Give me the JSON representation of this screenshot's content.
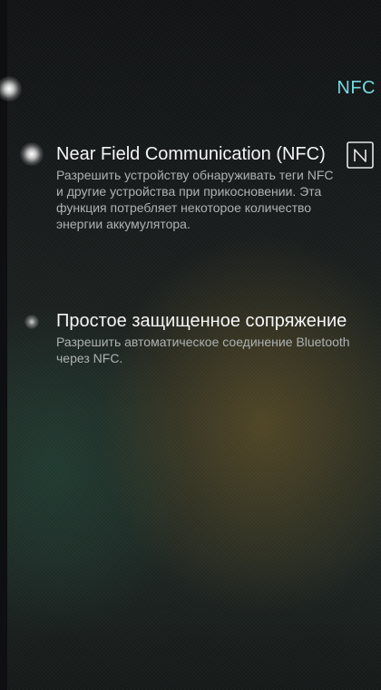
{
  "header": {
    "title": "NFC"
  },
  "settings": [
    {
      "title": "Near Field Communication (NFC)",
      "description": "Разрешить устройству обнаруживать теги NFC и другие устройства при прикосновении. Эта функция потребляет некоторое количество энергии аккумулятора.",
      "icon": "nfc-n-icon"
    },
    {
      "title": "Простое защищенное сопряжение",
      "description": "Разрешить автоматическое соединение Bluetooth через NFC."
    }
  ],
  "colors": {
    "accent": "#74d9df",
    "title_text": "#f5f5f5",
    "secondary_text": "#aeb3b2"
  }
}
